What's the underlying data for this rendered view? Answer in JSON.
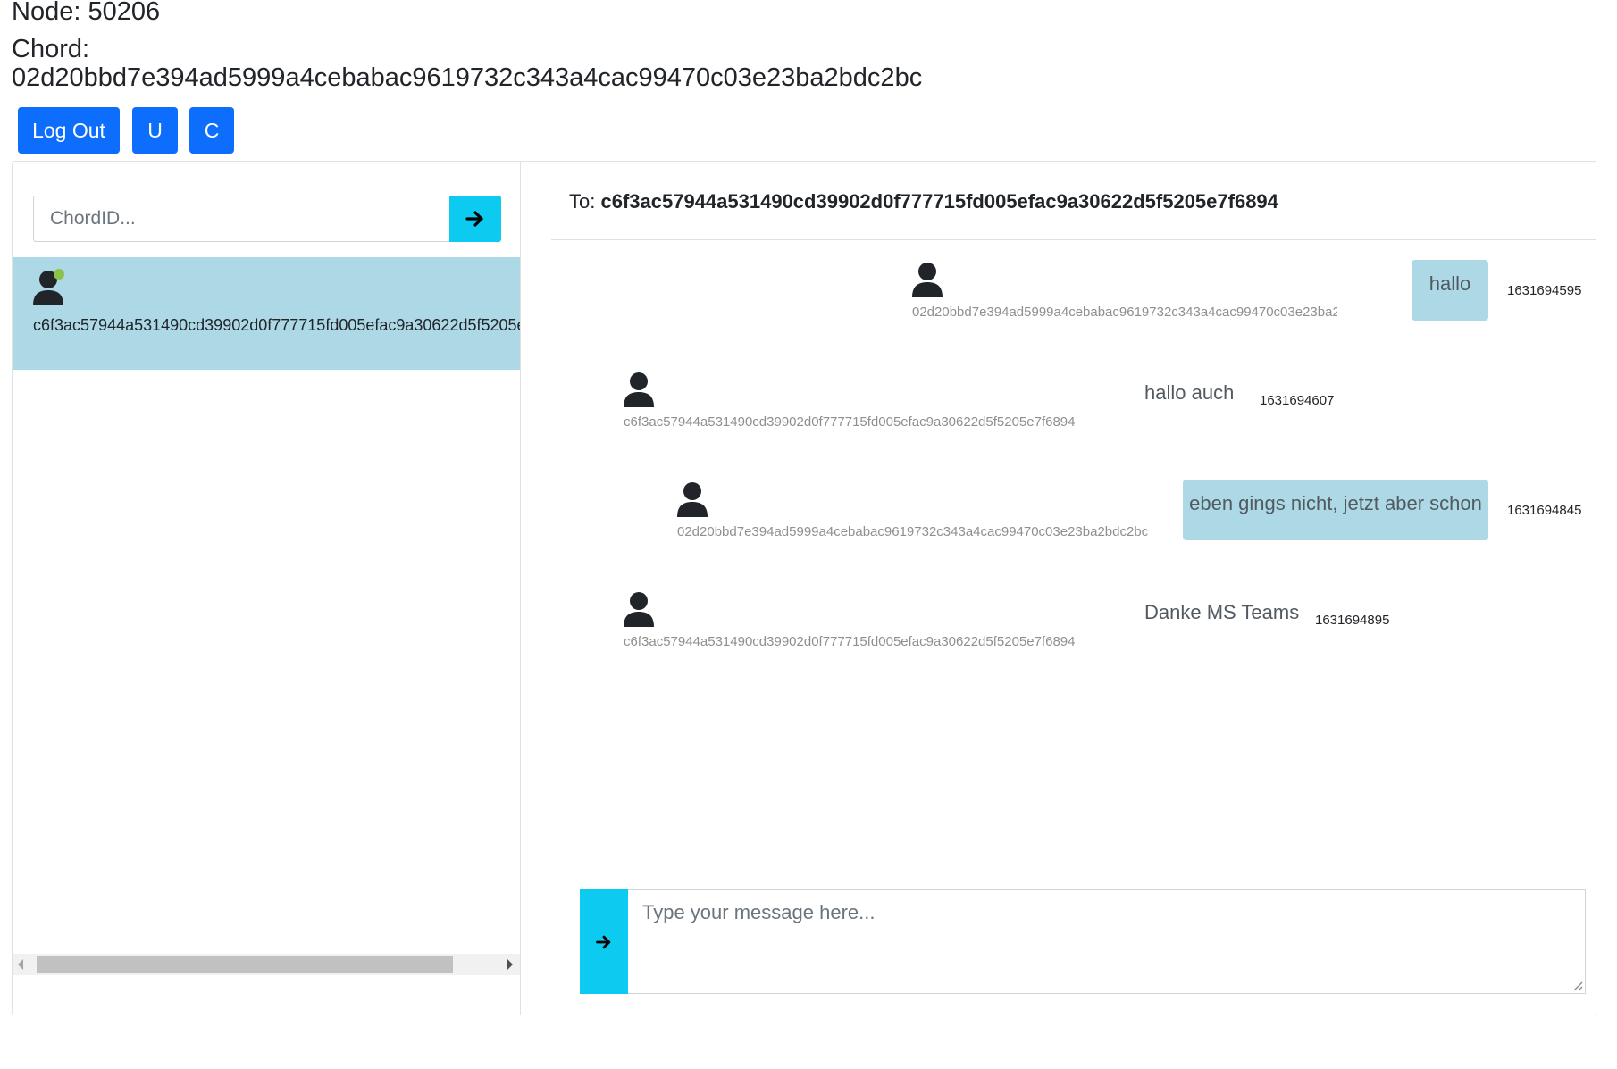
{
  "header": {
    "node": "Node: 50206",
    "chord_label": "Chord:",
    "chord_id": "02d20bbd7e394ad5999a4cebabac9619732c343a4cac99470c03e23ba2bdc2bc"
  },
  "buttons": {
    "logout": "Log Out",
    "u": "U",
    "c": "C"
  },
  "colors": {
    "primary": "#0d6efd",
    "info": "#0dcaf0",
    "selected": "#add8e6",
    "online": "#8bc34a"
  },
  "sidebar": {
    "search_placeholder": "ChordID...",
    "search_icon": "arrow-right-icon",
    "contacts": [
      {
        "id": "c6f3ac57944a531490cd39902d0f777715fd005efac9a30622d5f5205e7f6894",
        "online": true,
        "selected": true
      }
    ]
  },
  "chat": {
    "to_label": "To:",
    "to_id": "c6f3ac57944a531490cd39902d0f777715fd005efac9a30622d5f5205e7f6894",
    "messages": [
      {
        "sender": "02d20bbd7e394ad5999a4cebabac9619732c343a4cac99470c03e23ba2bdc2bc",
        "text": "hallo",
        "time": "1631694595",
        "own": true
      },
      {
        "sender": "c6f3ac57944a531490cd39902d0f777715fd005efac9a30622d5f5205e7f6894",
        "text": "hallo auch",
        "time": "1631694607",
        "own": false
      },
      {
        "sender": "02d20bbd7e394ad5999a4cebabac9619732c343a4cac99470c03e23ba2bdc2bc",
        "text": "eben gings nicht, jetzt aber schon",
        "time": "1631694845",
        "own": true
      },
      {
        "sender": "c6f3ac57944a531490cd39902d0f777715fd005efac9a30622d5f5205e7f6894",
        "text": "Danke MS Teams",
        "time": "1631694895",
        "own": false
      }
    ],
    "composer_placeholder": "Type your message here...",
    "send_icon": "arrow-right-icon"
  }
}
